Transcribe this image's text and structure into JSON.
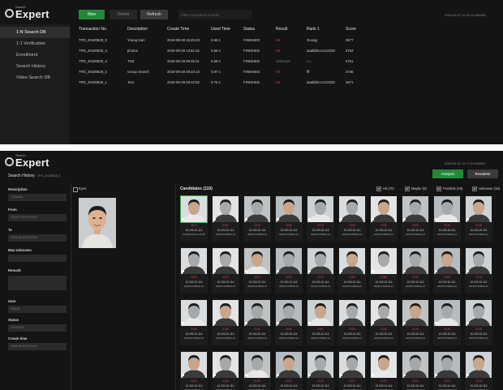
{
  "app": {
    "logo_small": "Search",
    "logo_text": "Expert"
  },
  "panel1": {
    "timestamp": "2018.08.27 16:00:10 ADMIN",
    "sidebar": [
      {
        "label": "1:N Search DB",
        "active": true
      },
      {
        "label": "1:1 Verification"
      },
      {
        "label": "Enrollment"
      },
      {
        "label": "Search History"
      },
      {
        "label": "Video Search DB"
      }
    ],
    "toolbar": {
      "new_label": "New",
      "delete_label": "Delete",
      "refresh_label": "Refresh",
      "search_placeholder": "Filter requested records"
    },
    "table": {
      "headers": [
        "Transaction No.",
        "Description",
        "Create Time",
        "Used Time",
        "Status",
        "Result",
        "Rank 1",
        "Score"
      ],
      "rows": [
        {
          "transaction": "TPD_20180828_5",
          "description": "Young man",
          "create_time": "2018-08-28 16:25:23",
          "used_time": "0.66 s",
          "status": "FINISHED",
          "result": "Hit",
          "rank1": "Gunag",
          "score": "3677"
        },
        {
          "transaction": "TPD_20180828_4",
          "description": "photo1",
          "create_time": "2018-08-28 13:51:32",
          "used_time": "0.66 s",
          "status": "FINISHED",
          "result": "Hit",
          "rank1": "aaabbbccc112233",
          "score": "3753"
        },
        {
          "transaction": "TPD_20180828_3",
          "description": "TDZ",
          "create_time": "2018-08-28 09:25:21",
          "used_time": "0.68 s",
          "status": "FINISHED",
          "result": "Unknown",
          "rank1": "Lo",
          "score": "2761"
        },
        {
          "transaction": "TPD_20180828_2",
          "description": "Group Search",
          "create_time": "2018-08-28 09:23:18",
          "used_time": "0.97 s",
          "status": "FINISHED",
          "result": "Hit",
          "rank1": "fff",
          "score": "3746"
        },
        {
          "transaction": "TPD_20180828_1",
          "description": "Tom",
          "create_time": "2018-08-28 09:22:52",
          "used_time": "0.75 s",
          "status": "FINISHED",
          "result": "Hit",
          "rank1": "aaabbbccc112233",
          "score": "3671"
        }
      ]
    }
  },
  "panel2": {
    "timestamp": "2018.08.31 11:17:53 ADMIN",
    "breadcrumb": "Search History",
    "breadcrumb_sub": "TPD_20180828_1",
    "analysis_label": "Analysis",
    "resubmit_label": "Resubmit",
    "form": {
      "description_label": "Description",
      "description_value": "To Bruma",
      "from_label": "From",
      "from_value": "2018-07-25 00:00:00",
      "to_label": "To",
      "to_value": "2018-08-28 23:59:59",
      "max_unknown_label": "Max Unknown",
      "max_unknown_value": "",
      "remark_label": "Remark",
      "user_label": "User",
      "user_value": "ADMIN",
      "status_label": "Status",
      "status_value": "FINISHED",
      "create_time_label": "Create time",
      "create_time_value": "2018-08-28 09:22:43"
    },
    "eyes_label": "Eyes",
    "candidates_title": "Candidates (110)",
    "filters": [
      {
        "label": "Hit (70)"
      },
      {
        "label": "Maybe (9)"
      },
      {
        "label": "Possible (16)"
      },
      {
        "label": "Unknown (18)"
      }
    ],
    "cards": [
      {
        "score": "3671",
        "ip": "10.200.10.114",
        "ts": "2018072707211.24.08",
        "match": true
      },
      {
        "score": "3390",
        "ip": "10.200.10.114",
        "ts": "2018072708542.10"
      },
      {
        "score": "3318",
        "ip": "10.200.10.114",
        "ts": "2018072708542.10"
      },
      {
        "score": "3282",
        "ip": "10.200.10.114",
        "ts": "2018072708542.10"
      },
      {
        "score": "3278",
        "ip": "10.200.10.114",
        "ts": "2018072708542.10"
      },
      {
        "score": "3238",
        "ip": "10.200.10.114",
        "ts": "2018072708542.10"
      },
      {
        "score": "3225",
        "ip": "10.200.10.114",
        "ts": "2018072708542.10"
      },
      {
        "score": "3222",
        "ip": "10.200.10.114",
        "ts": "2018072708542.10"
      },
      {
        "score": "3218",
        "ip": "10.200.10.114",
        "ts": "2018072708542.10"
      },
      {
        "score": "3216",
        "ip": "10.200.10.114",
        "ts": "2018072708542.10"
      },
      {
        "score": "3209",
        "ip": "10.200.10.114",
        "ts": "2018072708542.10"
      },
      {
        "score": "3205",
        "ip": "10.200.10.114",
        "ts": "2018072708542.10"
      },
      {
        "score": "3204",
        "ip": "10.200.10.114",
        "ts": "2018072708542.10"
      },
      {
        "score": "3202",
        "ip": "10.200.10.114",
        "ts": "2018072708542.10"
      },
      {
        "score": "3193",
        "ip": "10.200.10.114",
        "ts": "2018072708542.10"
      },
      {
        "score": "3189",
        "ip": "10.200.10.114",
        "ts": "2018072708542.10"
      },
      {
        "score": "3185",
        "ip": "10.200.10.114",
        "ts": "2018072708542.10"
      },
      {
        "score": "3183",
        "ip": "10.200.10.114",
        "ts": "2018072708542.10"
      },
      {
        "score": "3180",
        "ip": "10.200.10.114",
        "ts": "2018072708542.10"
      },
      {
        "score": "3175",
        "ip": "10.200.10.114",
        "ts": "2018072708542.10"
      },
      {
        "score": "3169",
        "ip": "10.200.10.114",
        "ts": "2018072708542.10"
      },
      {
        "score": "3165",
        "ip": "10.200.10.114",
        "ts": "2018072708542.10"
      },
      {
        "score": "3163",
        "ip": "10.200.10.114",
        "ts": "2018072708542.10"
      },
      {
        "score": "3160",
        "ip": "10.200.10.114",
        "ts": "2018072708542.10"
      },
      {
        "score": "3157",
        "ip": "10.200.10.114",
        "ts": "2018072708542.10"
      },
      {
        "score": "3154",
        "ip": "10.200.10.114",
        "ts": "2018072708542.10"
      },
      {
        "score": "3152",
        "ip": "10.200.10.114",
        "ts": "2018072708542.10"
      },
      {
        "score": "3149",
        "ip": "10.200.10.114",
        "ts": "2018072708542.10"
      },
      {
        "score": "3146",
        "ip": "10.200.10.114",
        "ts": "2018072708542.10"
      },
      {
        "score": "3143",
        "ip": "10.200.10.114",
        "ts": "2018072708542.10"
      },
      {
        "score": "3140",
        "ip": "10.200.10.114",
        "ts": "2018072708542.10"
      },
      {
        "score": "3138",
        "ip": "10.200.10.114",
        "ts": "2018072708542.10"
      },
      {
        "score": "3135",
        "ip": "10.200.10.114",
        "ts": "2018072708542.10"
      },
      {
        "score": "3132",
        "ip": "10.200.10.114",
        "ts": "2018072708542.10"
      },
      {
        "score": "3130",
        "ip": "10.200.10.114",
        "ts": "2018072708542.10"
      },
      {
        "score": "3127",
        "ip": "10.200.10.114",
        "ts": "2018072708542.10"
      },
      {
        "score": "3125",
        "ip": "10.200.10.114",
        "ts": "2018072708542.10"
      },
      {
        "score": "3122",
        "ip": "10.200.10.114",
        "ts": "2018072708542.10"
      },
      {
        "score": "3120",
        "ip": "10.200.10.114",
        "ts": "2018072708542.10"
      },
      {
        "score": "3118",
        "ip": "10.200.10.114",
        "ts": "2018072708542.10"
      }
    ]
  },
  "colors": {
    "accent_green": "#23893a",
    "hit_red": "#e03a3a",
    "bg_dark": "#141414"
  }
}
